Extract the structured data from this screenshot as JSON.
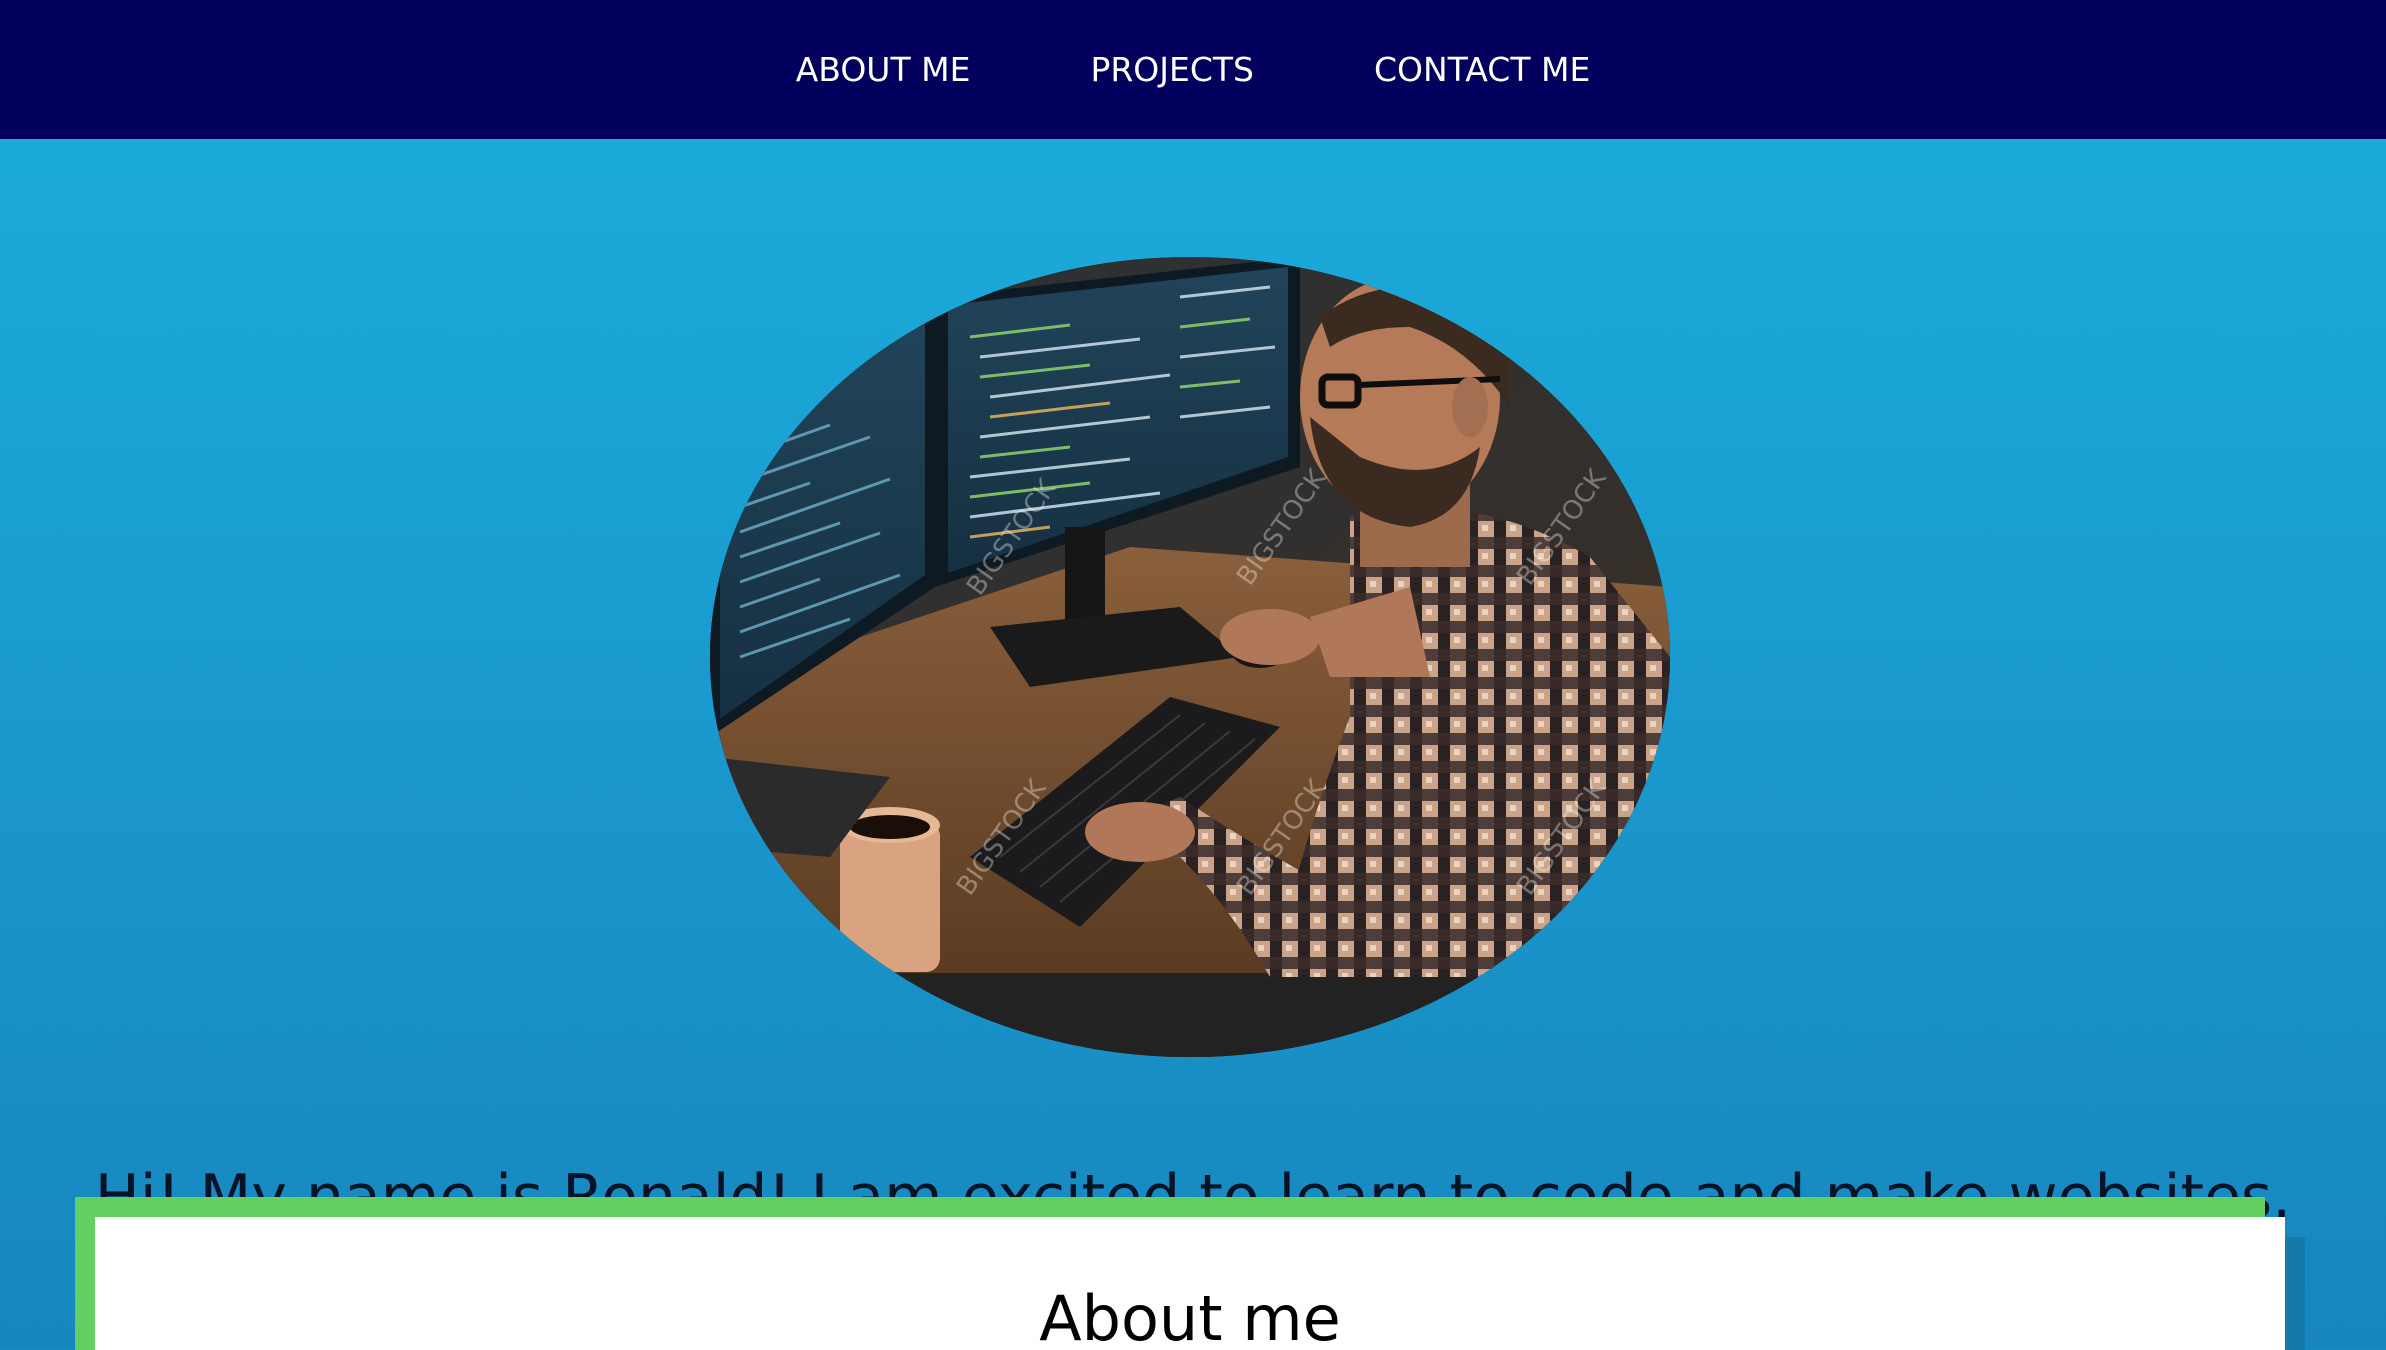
{
  "nav": {
    "items": [
      {
        "label": "ABOUT ME"
      },
      {
        "label": "PROJECTS"
      },
      {
        "label": "CONTACT ME"
      }
    ]
  },
  "hero": {
    "photo_watermark": "BIGSTOCK",
    "intro": "Hi! My name is Ronald! I am excited to learn to code and make websites."
  },
  "about": {
    "title": "About me"
  },
  "colors": {
    "nav_background": "#02005c",
    "page_gradient_top": "#1bb0de",
    "page_gradient_bottom": "#1786be",
    "card_border": "#63cf63",
    "card_background": "#ffffff"
  }
}
